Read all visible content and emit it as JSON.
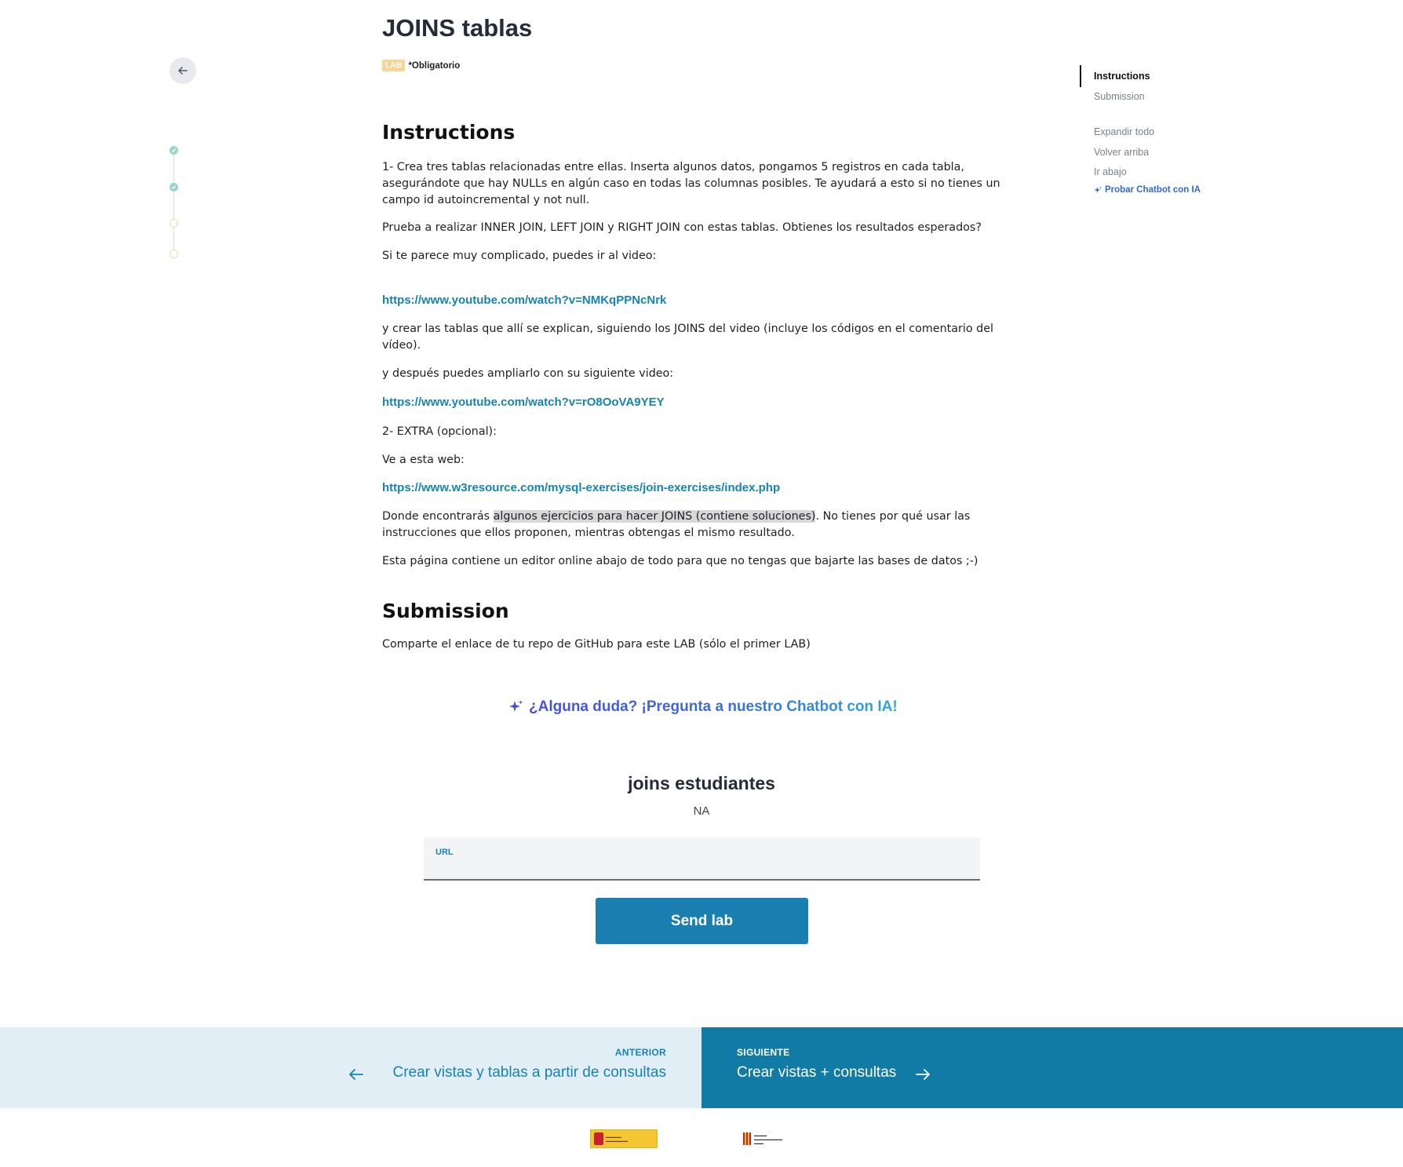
{
  "page": {
    "title": "JOINS tablas",
    "badge": "LAB",
    "mandatory": "*Obligatorio"
  },
  "progress": {
    "steps": [
      "done",
      "done",
      "todo",
      "todo"
    ]
  },
  "instructions": {
    "heading": "Instructions",
    "p1": "1- Crea tres tablas relacionadas entre ellas. Inserta algunos datos, pongamos 5 registros en cada tabla, asegurándote que hay NULLs en algún caso en todas las columnas posibles. Te ayudará a esto si no tienes un campo id autoincremental y not null.",
    "p2": "Prueba a realizar INNER JOIN, LEFT JOIN y RIGHT JOIN con estas tablas. Obtienes los resultados esperados?",
    "p3": "Si te parece muy complicado, puedes ir al video:",
    "link1": "https://www.youtube.com/watch?v=NMKqPPNcNrk",
    "p4": "y crear las tablas que allí se explican, siguiendo los JOINS del video (incluye los códigos en el comentario del vídeo).",
    "p5": "y después puedes ampliarlo con su siguiente video:",
    "link2": "https://www.youtube.com/watch?v=rO8OoVA9YEY",
    "p6": "2- EXTRA (opcional):",
    "p7": "Ve a esta web:",
    "link3": "https://www.w3resource.com/mysql-exercises/join-exercises/index.php",
    "p8_before": "Donde encontrarás ",
    "p8_highlight": "algunos ejercicios para hacer JOINS (contiene soluciones)",
    "p8_after": ". No tienes por qué usar las instrucciones que ellos proponen, mientras obtengas el mismo resultado.",
    "p9": "Esta página contiene un editor online abajo de todo para que no tengas que bajarte las bases de datos  ;-)"
  },
  "submission": {
    "heading": "Submission",
    "text": "Comparte el enlace de tu repo de GitHub para este LAB (sólo el primer LAB)"
  },
  "chatbot_cta": "¿Alguna duda? ¡Pregunta a nuestro Chatbot con IA!",
  "form": {
    "title": "joins estudiantes",
    "subtitle": "NA",
    "url_label": "URL",
    "url_value": "",
    "submit_label": "Send lab"
  },
  "pager": {
    "prev_kicker": "ANTERIOR",
    "prev_label": "Crear vistas y tablas a partir de consultas",
    "next_kicker": "SIGUIENTE",
    "next_label": "Crear vistas + consultas"
  },
  "toc": {
    "items": [
      "Instructions",
      "Submission"
    ],
    "actions": [
      "Expandir todo",
      "Volver arriba",
      "Ir abajo"
    ],
    "ai_label": "Probar Chatbot con IA"
  },
  "colors": {
    "accent": "#1683b3",
    "next_bg": "#117aa5",
    "prev_bg": "#e2eef6",
    "badge": "#f6d596",
    "progress_done": "#9bd3cf",
    "progress_todo": "#f0dca4"
  },
  "icons": {
    "back": "arrow-left-icon",
    "sparkle": "sparkle-icon",
    "check": "check-icon"
  }
}
